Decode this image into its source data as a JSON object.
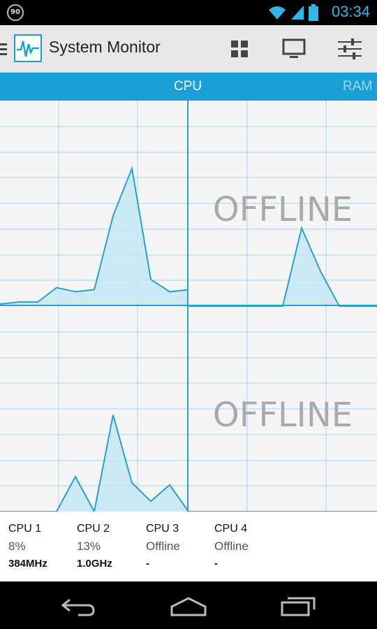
{
  "status_bar": {
    "notification_badge": "90",
    "time": "03:34"
  },
  "action_bar": {
    "title": "System Monitor"
  },
  "tabs": [
    {
      "label": "CPU"
    },
    {
      "label": "RAM"
    }
  ],
  "graphs": {
    "offline_label_1": "OFFLINE",
    "offline_label_2": "OFFLINE"
  },
  "chart_data": {
    "type": "area",
    "y_range": [
      0,
      100
    ],
    "series": [
      {
        "values": [
          1,
          2,
          2,
          9,
          7,
          8,
          44,
          67,
          13,
          7,
          8
        ]
      },
      {
        "values": [
          0,
          0,
          0,
          0,
          0,
          0,
          38,
          17,
          0,
          0,
          0
        ]
      },
      {
        "values": [
          0,
          0,
          0,
          0,
          17,
          0,
          47,
          14,
          5,
          13,
          0
        ]
      },
      {
        "values": [
          0,
          0,
          0,
          0,
          0,
          0,
          0,
          0,
          0,
          0,
          0
        ]
      }
    ]
  },
  "legend": [
    {
      "name": "CPU 1",
      "usage": "8%",
      "freq": "384MHz"
    },
    {
      "name": "CPU 2",
      "usage": "13%",
      "freq": "1.0GHz"
    },
    {
      "name": "CPU 3",
      "usage": "Offline",
      "freq": "-"
    },
    {
      "name": "CPU 4",
      "usage": "Offline",
      "freq": "-"
    }
  ],
  "colors": {
    "accent": "#1aa0d5",
    "graph_line": "#2a9fd0",
    "graph_fill": "#c5e6f3",
    "grid": "#a9d8ee"
  }
}
